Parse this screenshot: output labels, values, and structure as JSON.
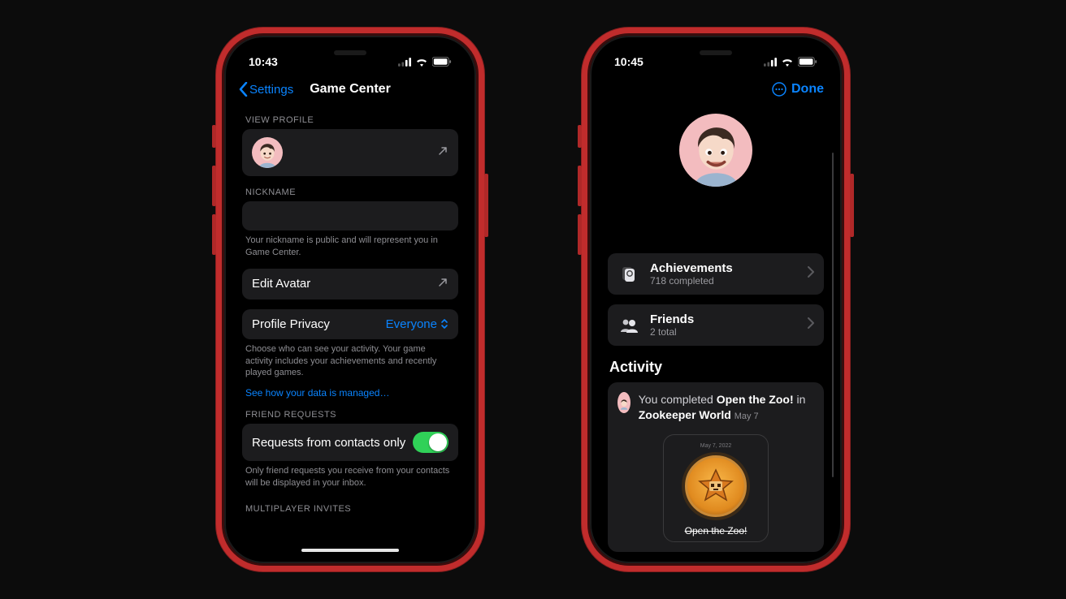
{
  "left": {
    "status_time": "10:43",
    "nav_back": "Settings",
    "nav_title": "Game Center",
    "section_view_profile": "VIEW PROFILE",
    "section_nickname": "NICKNAME",
    "nickname_footer": "Your nickname is public and will represent you in Game Center.",
    "edit_avatar": "Edit Avatar",
    "profile_privacy_label": "Profile Privacy",
    "profile_privacy_value": "Everyone",
    "privacy_footer": "Choose who can see your activity. Your game activity includes your achievements and recently played games.",
    "privacy_link": "See how your data is managed…",
    "section_friend_requests": "FRIEND REQUESTS",
    "requests_contacts_label": "Requests from contacts only",
    "requests_footer": "Only friend requests you receive from your contacts will be displayed in your inbox.",
    "section_multiplayer": "MULTIPLAYER INVITES"
  },
  "right": {
    "status_time": "10:45",
    "done": "Done",
    "achievements_title": "Achievements",
    "achievements_sub": "718 completed",
    "friends_title": "Friends",
    "friends_sub": "2 total",
    "activity_heading": "Activity",
    "activity_prefix": "You completed ",
    "activity_achievement": "Open the Zoo!",
    "activity_mid": " in ",
    "activity_game": "Zookeeper World",
    "activity_date": "May 7",
    "badge_title": "Open the Zoo!",
    "badge_date": "May 7, 2022"
  }
}
